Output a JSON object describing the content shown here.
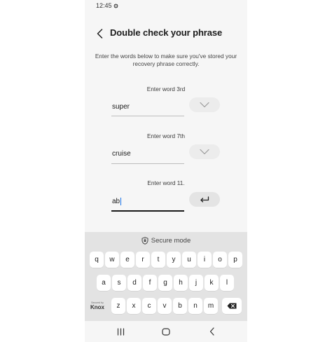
{
  "status_bar": {
    "time": "12:45",
    "settings_icon": "gear-icon"
  },
  "header": {
    "back_icon": "chevron-left-icon",
    "title": "Double check your phrase"
  },
  "subtitle": "Enter the words below to make sure you've stored your recovery phrase correctly.",
  "words": [
    {
      "label": "Enter word 3rd",
      "value": "super",
      "button_icon": "checkmark-icon",
      "active": false
    },
    {
      "label": "Enter word 7th",
      "value": "cruise",
      "button_icon": "checkmark-icon",
      "active": false
    },
    {
      "label": "Enter word 11.",
      "value": "ab",
      "button_icon": "enter-arrow-icon",
      "active": true
    }
  ],
  "keyboard": {
    "secure_label": "Secure mode",
    "rows": [
      [
        "q",
        "w",
        "e",
        "r",
        "t",
        "y",
        "u",
        "i",
        "o",
        "p"
      ],
      [
        "a",
        "s",
        "d",
        "f",
        "g",
        "h",
        "j",
        "k",
        "l"
      ],
      [
        "z",
        "x",
        "c",
        "v",
        "b",
        "n",
        "m"
      ]
    ],
    "knox_small": "Secured by",
    "knox_big": "Knox",
    "backspace_icon": "backspace-icon"
  },
  "nav_bar": {
    "recents_icon": "recents-icon",
    "home_icon": "home-icon",
    "back_icon": "back-icon"
  },
  "colors": {
    "caret": "#1a73e8",
    "keyboard_bg": "#e3e3e3",
    "screen_bg": "#f6f6f6"
  }
}
